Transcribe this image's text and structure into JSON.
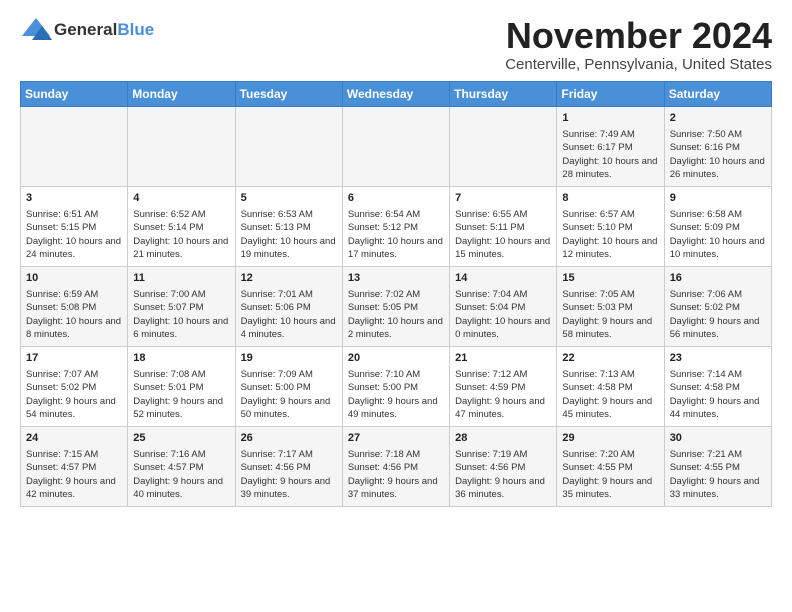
{
  "logo": {
    "general": "General",
    "blue": "Blue"
  },
  "title": "November 2024",
  "location": "Centerville, Pennsylvania, United States",
  "days_of_week": [
    "Sunday",
    "Monday",
    "Tuesday",
    "Wednesday",
    "Thursday",
    "Friday",
    "Saturday"
  ],
  "weeks": [
    [
      {
        "day": "",
        "info": ""
      },
      {
        "day": "",
        "info": ""
      },
      {
        "day": "",
        "info": ""
      },
      {
        "day": "",
        "info": ""
      },
      {
        "day": "",
        "info": ""
      },
      {
        "day": "1",
        "info": "Sunrise: 7:49 AM\nSunset: 6:17 PM\nDaylight: 10 hours and 28 minutes."
      },
      {
        "day": "2",
        "info": "Sunrise: 7:50 AM\nSunset: 6:16 PM\nDaylight: 10 hours and 26 minutes."
      }
    ],
    [
      {
        "day": "3",
        "info": "Sunrise: 6:51 AM\nSunset: 5:15 PM\nDaylight: 10 hours and 24 minutes."
      },
      {
        "day": "4",
        "info": "Sunrise: 6:52 AM\nSunset: 5:14 PM\nDaylight: 10 hours and 21 minutes."
      },
      {
        "day": "5",
        "info": "Sunrise: 6:53 AM\nSunset: 5:13 PM\nDaylight: 10 hours and 19 minutes."
      },
      {
        "day": "6",
        "info": "Sunrise: 6:54 AM\nSunset: 5:12 PM\nDaylight: 10 hours and 17 minutes."
      },
      {
        "day": "7",
        "info": "Sunrise: 6:55 AM\nSunset: 5:11 PM\nDaylight: 10 hours and 15 minutes."
      },
      {
        "day": "8",
        "info": "Sunrise: 6:57 AM\nSunset: 5:10 PM\nDaylight: 10 hours and 12 minutes."
      },
      {
        "day": "9",
        "info": "Sunrise: 6:58 AM\nSunset: 5:09 PM\nDaylight: 10 hours and 10 minutes."
      }
    ],
    [
      {
        "day": "10",
        "info": "Sunrise: 6:59 AM\nSunset: 5:08 PM\nDaylight: 10 hours and 8 minutes."
      },
      {
        "day": "11",
        "info": "Sunrise: 7:00 AM\nSunset: 5:07 PM\nDaylight: 10 hours and 6 minutes."
      },
      {
        "day": "12",
        "info": "Sunrise: 7:01 AM\nSunset: 5:06 PM\nDaylight: 10 hours and 4 minutes."
      },
      {
        "day": "13",
        "info": "Sunrise: 7:02 AM\nSunset: 5:05 PM\nDaylight: 10 hours and 2 minutes."
      },
      {
        "day": "14",
        "info": "Sunrise: 7:04 AM\nSunset: 5:04 PM\nDaylight: 10 hours and 0 minutes."
      },
      {
        "day": "15",
        "info": "Sunrise: 7:05 AM\nSunset: 5:03 PM\nDaylight: 9 hours and 58 minutes."
      },
      {
        "day": "16",
        "info": "Sunrise: 7:06 AM\nSunset: 5:02 PM\nDaylight: 9 hours and 56 minutes."
      }
    ],
    [
      {
        "day": "17",
        "info": "Sunrise: 7:07 AM\nSunset: 5:02 PM\nDaylight: 9 hours and 54 minutes."
      },
      {
        "day": "18",
        "info": "Sunrise: 7:08 AM\nSunset: 5:01 PM\nDaylight: 9 hours and 52 minutes."
      },
      {
        "day": "19",
        "info": "Sunrise: 7:09 AM\nSunset: 5:00 PM\nDaylight: 9 hours and 50 minutes."
      },
      {
        "day": "20",
        "info": "Sunrise: 7:10 AM\nSunset: 5:00 PM\nDaylight: 9 hours and 49 minutes."
      },
      {
        "day": "21",
        "info": "Sunrise: 7:12 AM\nSunset: 4:59 PM\nDaylight: 9 hours and 47 minutes."
      },
      {
        "day": "22",
        "info": "Sunrise: 7:13 AM\nSunset: 4:58 PM\nDaylight: 9 hours and 45 minutes."
      },
      {
        "day": "23",
        "info": "Sunrise: 7:14 AM\nSunset: 4:58 PM\nDaylight: 9 hours and 44 minutes."
      }
    ],
    [
      {
        "day": "24",
        "info": "Sunrise: 7:15 AM\nSunset: 4:57 PM\nDaylight: 9 hours and 42 minutes."
      },
      {
        "day": "25",
        "info": "Sunrise: 7:16 AM\nSunset: 4:57 PM\nDaylight: 9 hours and 40 minutes."
      },
      {
        "day": "26",
        "info": "Sunrise: 7:17 AM\nSunset: 4:56 PM\nDaylight: 9 hours and 39 minutes."
      },
      {
        "day": "27",
        "info": "Sunrise: 7:18 AM\nSunset: 4:56 PM\nDaylight: 9 hours and 37 minutes."
      },
      {
        "day": "28",
        "info": "Sunrise: 7:19 AM\nSunset: 4:56 PM\nDaylight: 9 hours and 36 minutes."
      },
      {
        "day": "29",
        "info": "Sunrise: 7:20 AM\nSunset: 4:55 PM\nDaylight: 9 hours and 35 minutes."
      },
      {
        "day": "30",
        "info": "Sunrise: 7:21 AM\nSunset: 4:55 PM\nDaylight: 9 hours and 33 minutes."
      }
    ]
  ]
}
